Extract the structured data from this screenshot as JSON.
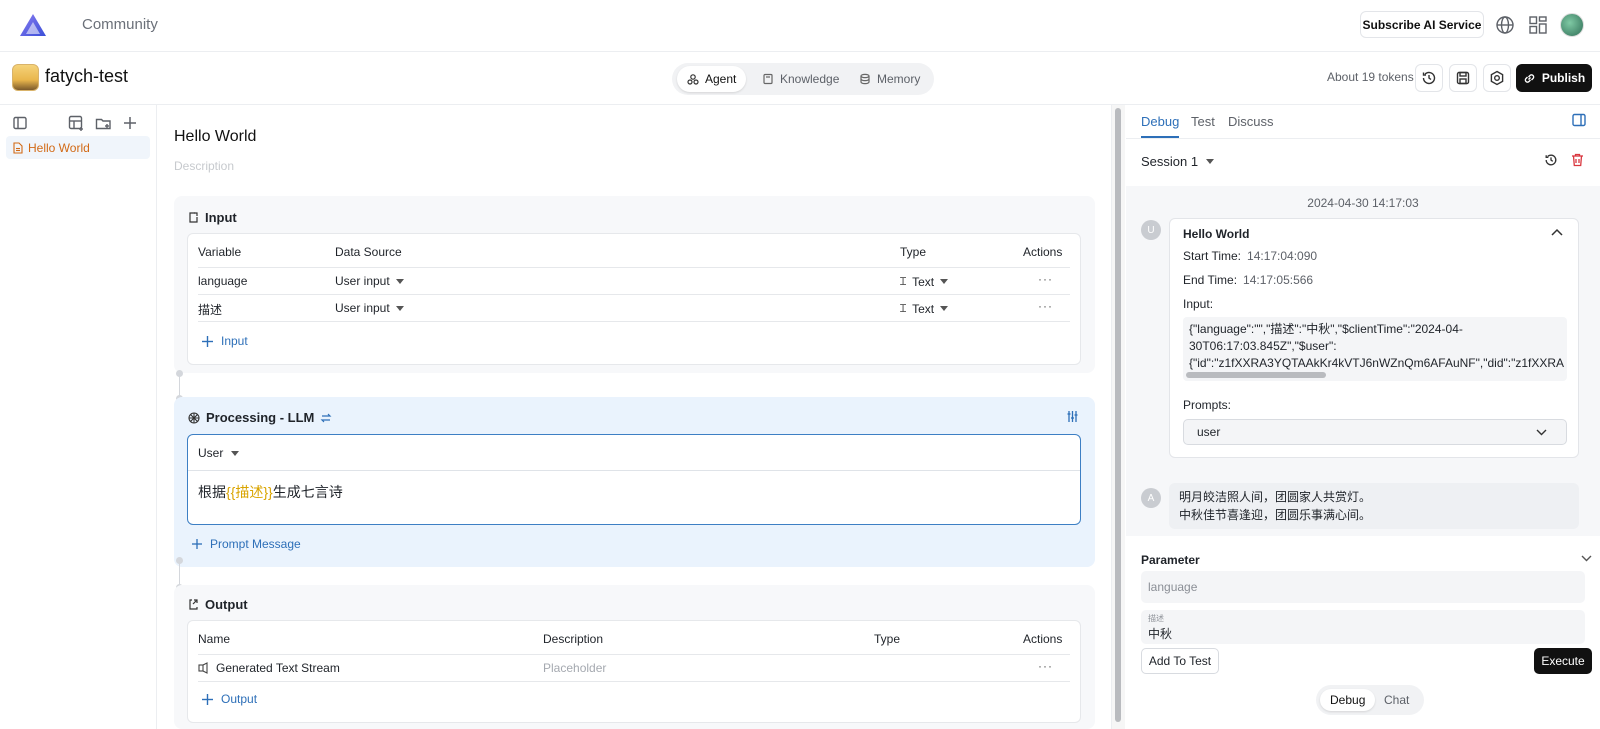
{
  "topbar": {
    "brand": "Community",
    "subscribe_label": "Subscribe AI Service",
    "icons": [
      "globe-icon",
      "grid-icon",
      "user-avatar"
    ]
  },
  "project": {
    "name": "fatych-test",
    "tabs": [
      {
        "label": "Agent",
        "icon": "agent-icon",
        "active": true
      },
      {
        "label": "Knowledge",
        "icon": "book-icon",
        "active": false
      },
      {
        "label": "Memory",
        "icon": "database-icon",
        "active": false
      }
    ],
    "tokens": "About 19 tokens",
    "publish_label": "Publish"
  },
  "sidebar": {
    "items": [
      {
        "label": "Hello World",
        "active": true
      }
    ]
  },
  "agent": {
    "title": "Hello World",
    "description_placeholder": "Description",
    "input": {
      "title": "Input",
      "columns": [
        "Variable",
        "Data Source",
        "Type",
        "Actions"
      ],
      "rows": [
        {
          "variable": "language",
          "source": "User input",
          "type": "Text",
          "actions": "···"
        },
        {
          "variable": "描述",
          "source": "User input",
          "type": "Text",
          "actions": "···"
        }
      ],
      "add_label": "Input"
    },
    "processing": {
      "title": "Processing - LLM",
      "role": "User",
      "prompt_prefix": "根据",
      "prompt_variable": "{{描述}}",
      "prompt_suffix": "生成七言诗",
      "add_label": "Prompt Message"
    },
    "output": {
      "title": "Output",
      "columns": [
        "Name",
        "Description",
        "Type",
        "Actions"
      ],
      "rows": [
        {
          "name": "Generated Text Stream",
          "description": "Placeholder",
          "type": "",
          "actions": "···"
        }
      ],
      "add_label": "Output"
    }
  },
  "right_panel": {
    "tabs": [
      {
        "label": "Debug",
        "active": true
      },
      {
        "label": "Test",
        "active": false
      },
      {
        "label": "Discuss",
        "active": false
      }
    ],
    "session": "Session 1",
    "chat": {
      "timestamp": "2024-04-30 14:17:03",
      "user_avatar": "U",
      "assistant_avatar": "A",
      "card": {
        "title": "Hello World",
        "start_label": "Start Time:",
        "start_value": "14:17:04:090",
        "end_label": "End Time:",
        "end_value": "14:17:05:566",
        "input_label": "Input:",
        "input_json": "{\"language\":\"\",\"描述\":\"中秋\",\"$clientTime\":\"2024-04-\n30T06:17:03.845Z\",\"$user\":\n{\"id\":\"z1fXXRA3YQTAAkKr4kVTJ6nWZnQm6AFAuNF\",\"did\":\"z1fXXRA",
        "prompts_label": "Prompts:",
        "prompts_value": "user"
      },
      "reply_lines": [
        "明月皎洁照人间，团圆家人共赏灯。",
        "中秋佳节喜逢迎，团圆乐事满心间。"
      ]
    },
    "parameter": {
      "title": "Parameter",
      "fields": [
        {
          "label": "",
          "value": "",
          "placeholder": "language"
        },
        {
          "label": "描述",
          "value": "中秋",
          "placeholder": ""
        }
      ]
    },
    "add_to_test_label": "Add To Test",
    "execute_label": "Execute",
    "modes": [
      {
        "label": "Debug",
        "active": true
      },
      {
        "label": "Chat",
        "active": false
      }
    ]
  }
}
